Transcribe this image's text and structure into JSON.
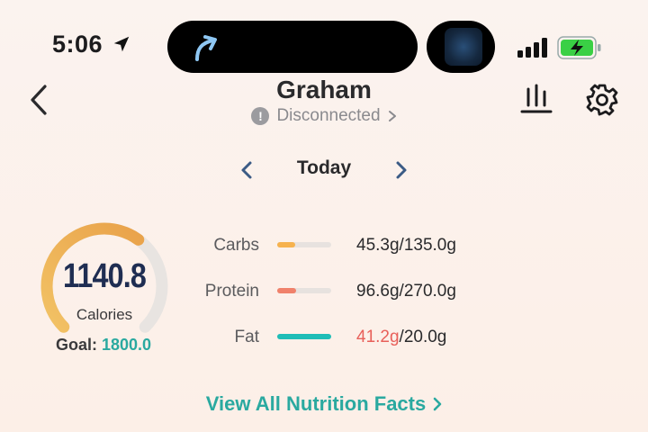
{
  "status_bar": {
    "time": "5:06",
    "island_icon": "arrow-turn-icon",
    "battery_state": "charging"
  },
  "header": {
    "name": "Graham",
    "status_text": "Disconnected",
    "status_icon": "!"
  },
  "date_nav": {
    "label": "Today"
  },
  "calories": {
    "value": "1140.8",
    "label": "Calories",
    "goal_label": "Goal:",
    "goal_value": "1800.0",
    "progress": 0.634
  },
  "macros": [
    {
      "name": "Carbs",
      "consumed": "45.3g",
      "goal": "/135.0g",
      "fraction": 0.336,
      "color": "#f6b24e",
      "over": false
    },
    {
      "name": "Protein",
      "consumed": "96.6g",
      "goal": "/270.0g",
      "fraction": 0.358,
      "color": "#f0816b",
      "over": false
    },
    {
      "name": "Fat",
      "consumed": "41.2g",
      "goal": "/20.0g",
      "fraction": 1.0,
      "color": "#1fbdb7",
      "over": true
    }
  ],
  "footer": {
    "view_all_label": "View All Nutrition Facts"
  },
  "colors": {
    "accent": "#2aa9a0",
    "over_limit": "#e8605a",
    "gauge_start": "#f2c265",
    "gauge_end": "#e9a24a",
    "gauge_track": "#e8e4e1"
  }
}
